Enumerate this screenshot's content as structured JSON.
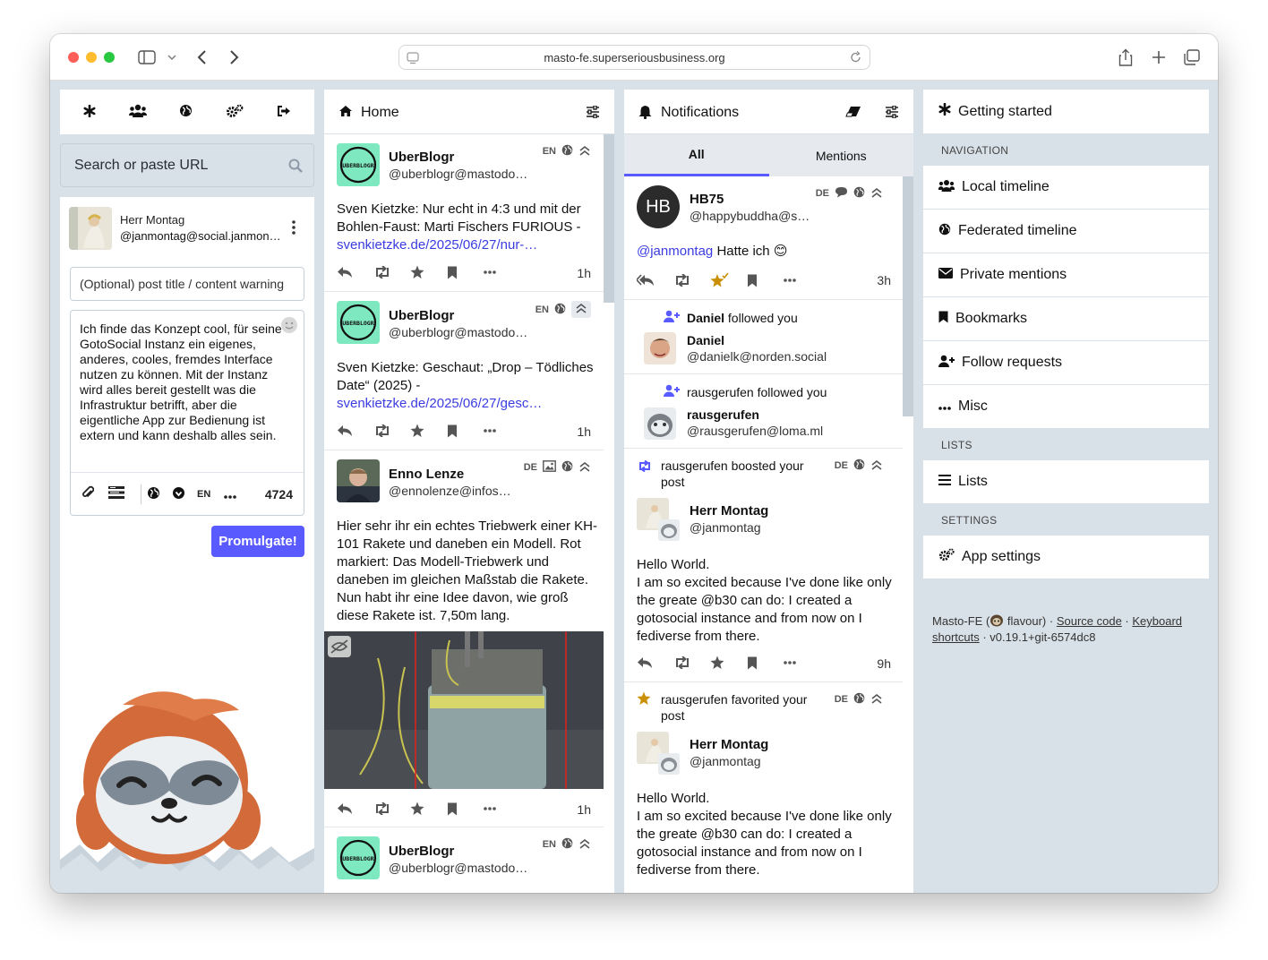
{
  "browser": {
    "url": "masto-fe.superseriousbusiness.org"
  },
  "search": {
    "placeholder": "Search or paste URL"
  },
  "compose": {
    "name": "Herr Montag",
    "handle": "@janmontag@social.janmon…",
    "cw_placeholder": "(Optional) post title / content warning",
    "text": "Ich finde das Konzept cool, für seine GotoSocial Instanz ein eigenes, anderes, cooles, fremdes Interface nutzen zu können. Mit der Instanz wird alles bereit gestellt was die Infrastruktur betrifft, aber die eigentliche App zur Bedienung ist extern und kann deshalb alles sein.",
    "lang": "EN",
    "count": "4724",
    "submit": "Promulgate!"
  },
  "home": {
    "title": "Home",
    "statuses": [
      {
        "name": "UberBlogr",
        "handle": "@uberblogr@mastodo…",
        "lang": "EN",
        "text": "Sven Kietzke: Nur echt in 4:3 und mit der Bohlen-Faust: Marti Fischers FURIOUS -",
        "link": "svenkietzke.de/2025/06/27/nur-…",
        "time": "1h"
      },
      {
        "name": "UberBlogr",
        "handle": "@uberblogr@mastodo…",
        "lang": "EN",
        "text": "Sven Kietzke: Geschaut: „Drop – Tödliches Date“ (2025) -",
        "link": "svenkietzke.de/2025/06/27/gesc…",
        "time": "1h"
      },
      {
        "name": "Enno Lenze",
        "handle": "@ennolenze@infos…",
        "lang": "DE",
        "text": "Hier sehr ihr ein echtes Triebwerk einer KH-101 Rakete und daneben ein Modell. Rot markiert: Das Modell-Triebwerk und daneben im gleichen Maßstab die Rakete. Nun habt ihr eine Idee davon, wie groß diese Rakete ist. 7,50m lang.",
        "time": "1h"
      },
      {
        "name": "UberBlogr",
        "handle": "@uberblogr@mastodo…",
        "lang": "EN"
      }
    ],
    "avatar_text": "UBERBLOGR"
  },
  "notifications": {
    "title": "Notifications",
    "tabs": [
      "All",
      "Mentions"
    ],
    "mention": {
      "initials": "HB",
      "name": "HB75",
      "handle": "@happybuddha@s…",
      "lang": "DE",
      "at": "@janmontag",
      "text": " Hatte ich",
      "emoji": "😊",
      "time": "3h"
    },
    "follow1": {
      "who": "Daniel",
      "action": " followed you",
      "name": "Daniel",
      "handle": "@danielk@norden.social"
    },
    "follow2": {
      "who": "rausgerufen",
      "action": " followed you",
      "name": "rausgerufen",
      "handle": "@rausgerufen@loma.ml"
    },
    "boost": {
      "line": "rausgerufen boosted your post",
      "lang": "DE",
      "name": "Herr Montag",
      "handle": "@janmontag",
      "text1": "Hello World.",
      "text2": "I am so excited because I've done like only the greate @b30 can do: I created a gotosocial instance and from now on I fediverse from there.",
      "time": "9h"
    },
    "fav": {
      "line": "rausgerufen favorited your post",
      "lang": "DE",
      "name": "Herr Montag",
      "handle": "@janmontag",
      "text1": "Hello World.",
      "text2": "I am so excited because I've done like only the greate @b30 can do: I created a gotosocial instance and from now on I fediverse from there."
    }
  },
  "nav": {
    "title": "Getting started",
    "sec_navigation": "NAVIGATION",
    "local": "Local timeline",
    "federated": "Federated timeline",
    "private": "Private mentions",
    "bookmarks": "Bookmarks",
    "follow_requests": "Follow requests",
    "misc": "Misc",
    "sec_lists": "LISTS",
    "lists": "Lists",
    "sec_settings": "SETTINGS",
    "app_settings": "App settings",
    "footer": {
      "a": "Masto-FE (",
      "b": " flavour) · ",
      "source": "Source code",
      "dot": " · ",
      "keyboard": "Keyboard shortcuts",
      "version": " · v0.19.1+git-6574dc8"
    }
  }
}
